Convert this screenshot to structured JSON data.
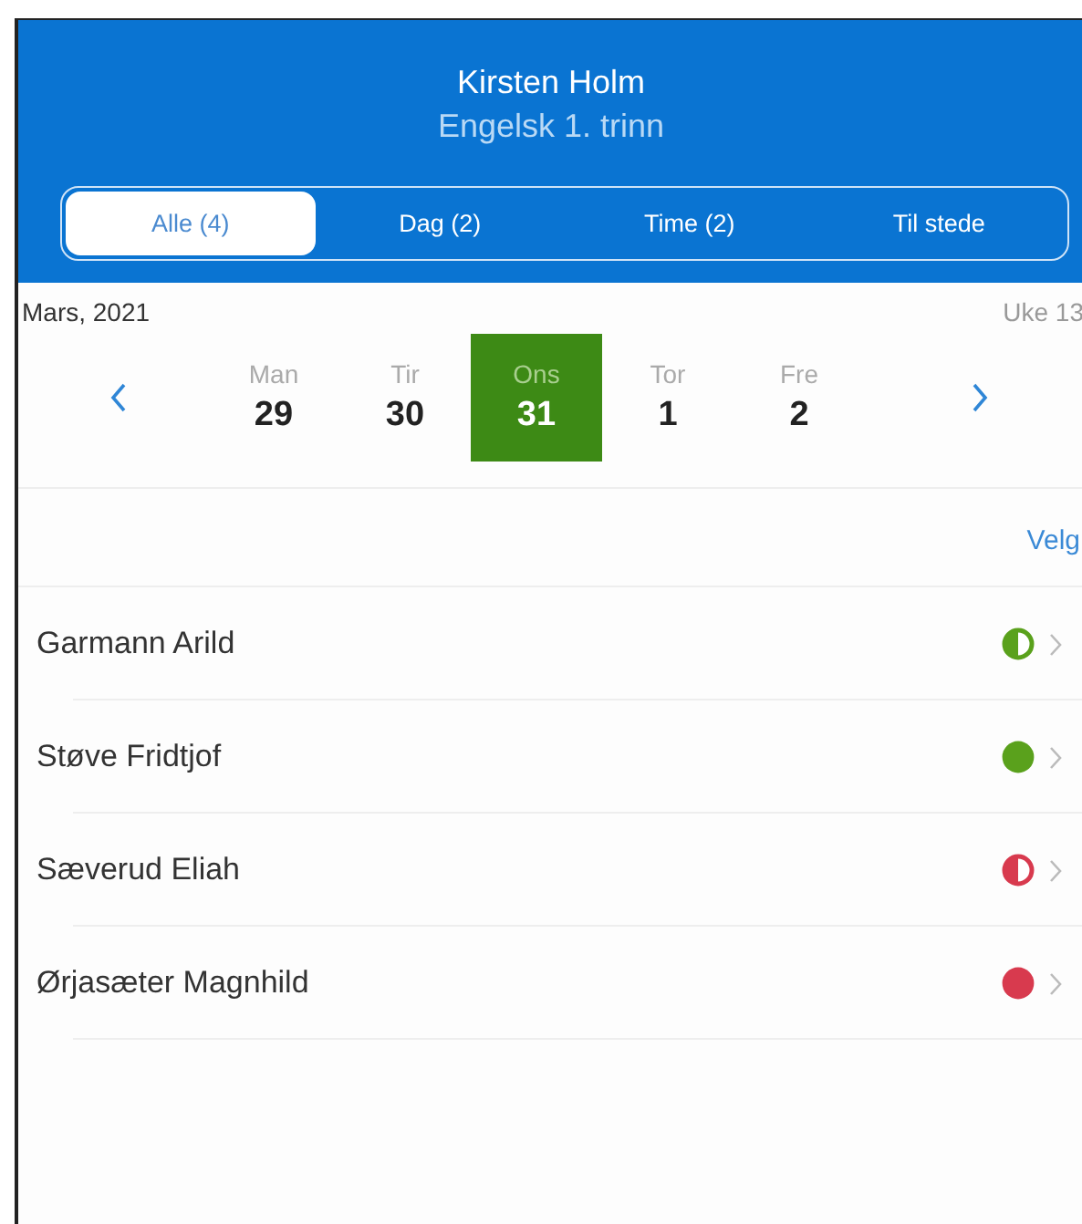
{
  "header": {
    "title": "Kirsten Holm",
    "subtitle": "Engelsk 1. trinn"
  },
  "tabs": [
    {
      "label": "Alle (4)",
      "selected": true
    },
    {
      "label": "Dag (2)",
      "selected": false
    },
    {
      "label": "Time (2)",
      "selected": false
    },
    {
      "label": "Til stede",
      "selected": false
    }
  ],
  "calendar": {
    "month": "Mars, 2021",
    "week": "Uke 13",
    "days": [
      {
        "weekday": "Man",
        "date": "29",
        "selected": false
      },
      {
        "weekday": "Tir",
        "date": "30",
        "selected": false
      },
      {
        "weekday": "Ons",
        "date": "31",
        "selected": true
      },
      {
        "weekday": "Tor",
        "date": "1",
        "selected": false
      },
      {
        "weekday": "Fre",
        "date": "2",
        "selected": false
      }
    ]
  },
  "select_link": "Velg",
  "students": [
    {
      "name": "Garmann Arild",
      "status": {
        "kind": "half",
        "color": "#5aa11c"
      }
    },
    {
      "name": "Støve Fridtjof",
      "status": {
        "kind": "full",
        "color": "#5aa11c"
      }
    },
    {
      "name": "Sæverud Eliah",
      "status": {
        "kind": "half",
        "color": "#d83a4e"
      }
    },
    {
      "name": "Ørjasæter Magnhild",
      "status": {
        "kind": "full",
        "color": "#d83a4e"
      }
    }
  ]
}
